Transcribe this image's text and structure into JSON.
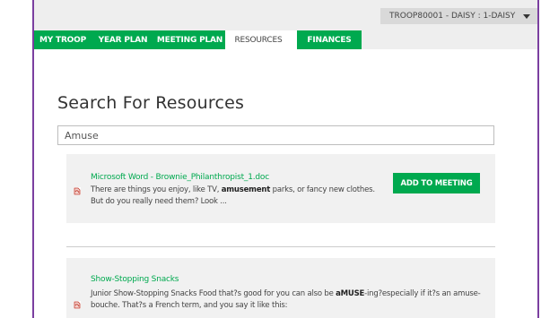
{
  "header": {
    "troop_selector": "TROOP80001 - DAISY : 1-DAISY"
  },
  "nav": {
    "tabs": [
      {
        "label": "MY TROOP"
      },
      {
        "label": "YEAR PLAN"
      },
      {
        "label": "MEETING PLAN"
      },
      {
        "label": "RESOURCES",
        "active": true
      },
      {
        "label": "FINANCES"
      }
    ]
  },
  "main": {
    "title": "Search For Resources",
    "search": {
      "value": "Amuse",
      "placeholder": ""
    },
    "results": [
      {
        "title": "Microsoft Word - Brownie_Philanthropist_1.doc",
        "desc_before": "There are things you enjoy, like TV, ",
        "desc_bold": "amusement",
        "desc_after": " parks, or fancy new clothes. But do you really need them? Look ...",
        "button_label": "ADD TO MEETING",
        "icon": "pdf-document-icon"
      },
      {
        "title": "Show-Stopping Snacks",
        "desc_before": "Junior Show-Stopping Snacks Food that?s good for you can also be ",
        "desc_bold": "aMUSE",
        "desc_after": "-ing?especially if it?s an amuse- bouche. That?s a French term, and you say it like this:",
        "icon": "pdf-document-icon"
      }
    ]
  },
  "colors": {
    "brand_green": "#00a94f",
    "frame_purple": "#7b3fa0"
  }
}
